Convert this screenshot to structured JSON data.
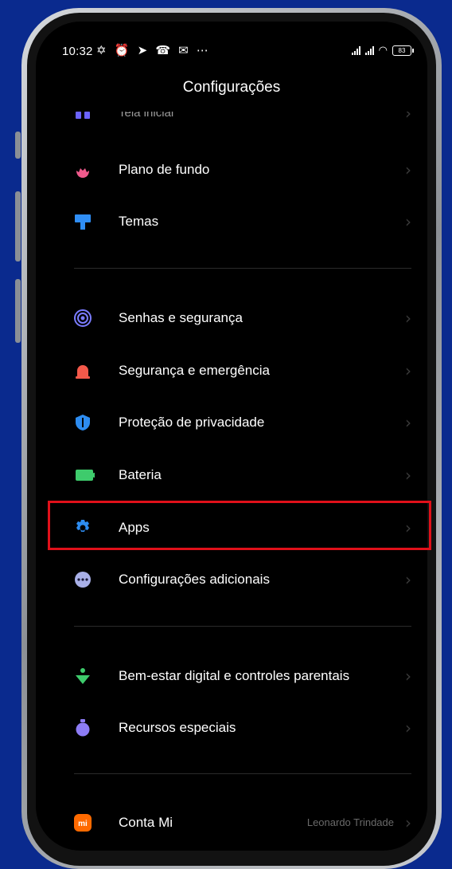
{
  "status_bar": {
    "time": "10:32",
    "notification_icons": "✡ ⏰ ➤ ☎ ✉ ⋯",
    "wifi": "◠",
    "battery": "83"
  },
  "header": {
    "title": "Configurações"
  },
  "items": [
    {
      "label": "Tela inicial",
      "icon": "home-screen-icon",
      "color": "#6b63ff"
    },
    {
      "label": "Plano de fundo",
      "icon": "flower-icon",
      "color": "#f05a8c"
    },
    {
      "label": "Temas",
      "icon": "brush-icon",
      "color": "#2f8ef5"
    },
    {
      "label": "Senhas e segurança",
      "icon": "fingerprint-icon",
      "color": "#7a7cff"
    },
    {
      "label": "Segurança e emergência",
      "icon": "alarm-light-icon",
      "color": "#f4594a"
    },
    {
      "label": "Proteção de privacidade",
      "icon": "privacy-shield-icon",
      "color": "#2d8cf0"
    },
    {
      "label": "Bateria",
      "icon": "battery-icon",
      "color": "#3ecb6c"
    },
    {
      "label": "Apps",
      "icon": "settings-gear-icon",
      "color": "#2d8cf0"
    },
    {
      "label": "Configurações adicionais",
      "icon": "more-dots-icon",
      "color": "#a9b0e8"
    },
    {
      "label": "Bem-estar digital e controles parentais",
      "icon": "wellbeing-icon",
      "color": "#3ecb6c"
    },
    {
      "label": "Recursos especiais",
      "icon": "special-features-icon",
      "color": "#8d7cf5"
    },
    {
      "label": "Conta Mi",
      "icon": "mi-logo-icon",
      "color": "#ff6a00",
      "value": "Leonardo Trindade"
    }
  ]
}
